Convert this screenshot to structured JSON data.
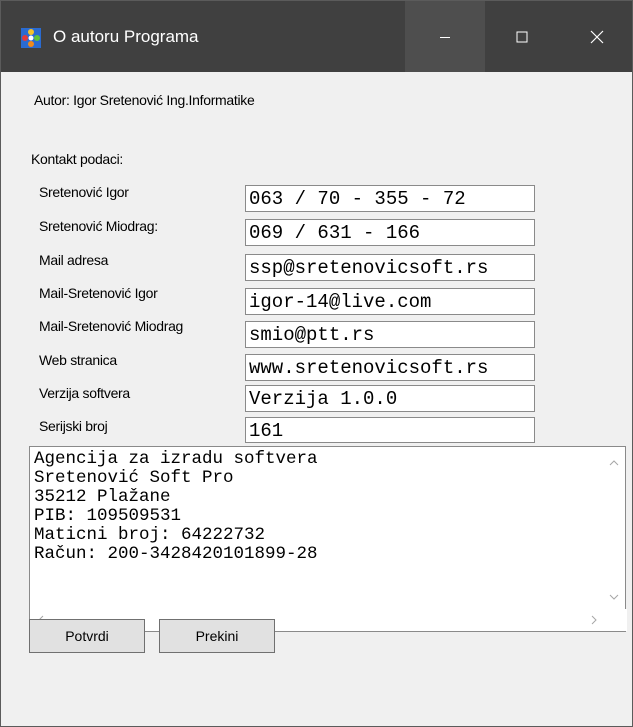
{
  "window": {
    "title": "O autoru Programa"
  },
  "titlebar": {
    "minimize_glyph": "—",
    "maximize_glyph": "☐",
    "close_glyph": "✕"
  },
  "author": {
    "text": "Autor: Igor Sretenović   Ing.Informatike"
  },
  "contact": {
    "heading": "Kontakt podaci:",
    "rows": [
      {
        "label": "Sretenović Igor",
        "value": "063 / 70 - 355 - 72"
      },
      {
        "label": "Sretenović Miodrag:",
        "value": "069 / 631 - 166"
      },
      {
        "label": "Mail adresa",
        "value": "ssp@sretenovicsoft.rs"
      },
      {
        "label": "Mail-Sretenović Igor",
        "value": "igor-14@live.com"
      },
      {
        "label": "Mail-Sretenović Miodrag",
        "value": "smio@ptt.rs"
      },
      {
        "label": "Web stranica",
        "value": "www.sretenovicsoft.rs"
      },
      {
        "label": "Verzija softvera",
        "value": "Verzija 1.0.0"
      },
      {
        "label": "Serijski broj",
        "value": "161"
      }
    ]
  },
  "memo": {
    "text": "Agencija za izradu softvera\nSretenović Soft Pro\n35212 Plažane\nPIB: 109509531\nMaticni broj: 64222732\nRačun: 200-3428420101899-28"
  },
  "buttons": {
    "confirm_label": "Potvrdi",
    "cancel_label": "Prekini"
  }
}
